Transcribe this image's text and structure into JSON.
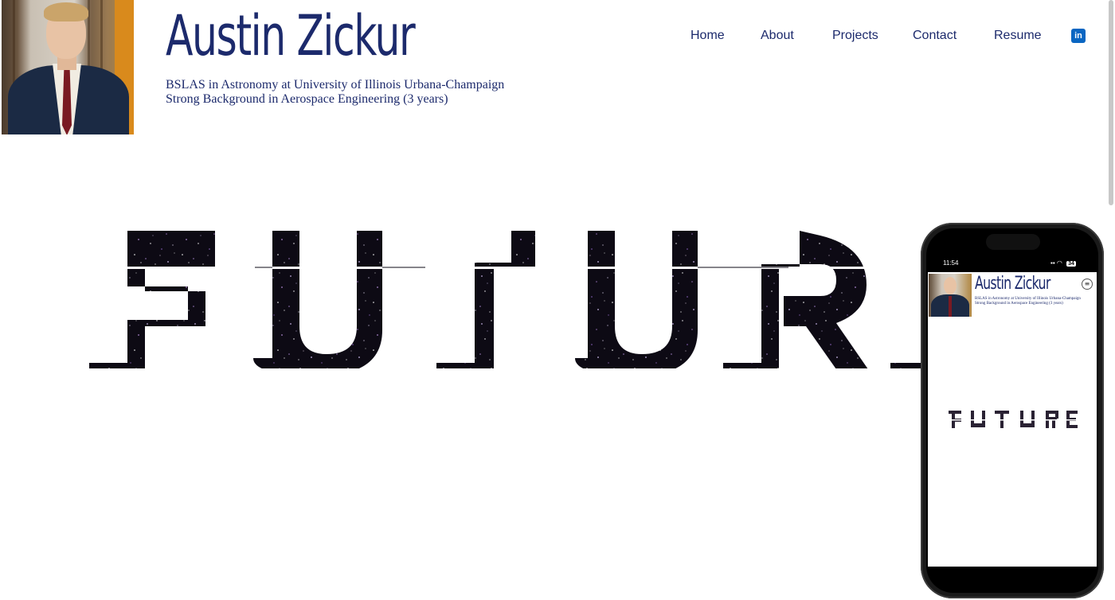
{
  "header": {
    "name": "Austin Zickur",
    "tagline_1": "BSLAS in Astronomy at University of Illinois Urbana-Champaign",
    "tagline_2": "Strong Background in Aerospace Engineering (3 years)"
  },
  "nav": {
    "items": [
      {
        "label": "Home"
      },
      {
        "label": "About"
      },
      {
        "label": "Projects"
      },
      {
        "label": "Contact"
      },
      {
        "label": "Resume"
      }
    ],
    "social_icon": "linkedin-icon",
    "social_glyph": "in"
  },
  "hero": {
    "word": "FUTURE",
    "fill": "starfield-texture"
  },
  "phone": {
    "status_time": "11:54",
    "battery": "34",
    "title": "Austin Zickur",
    "tagline_1": "BSLAS in Astronomy at University of Illinois Urbana-Champaign",
    "tagline_2": "Strong Background in Aerospace Engineering (3 years)",
    "word": "FUTURE",
    "menu_icon": "≡"
  },
  "colors": {
    "brand": "#1c2a6c",
    "linkedin": "#0a66c2",
    "star_base": "#0d0a14"
  }
}
